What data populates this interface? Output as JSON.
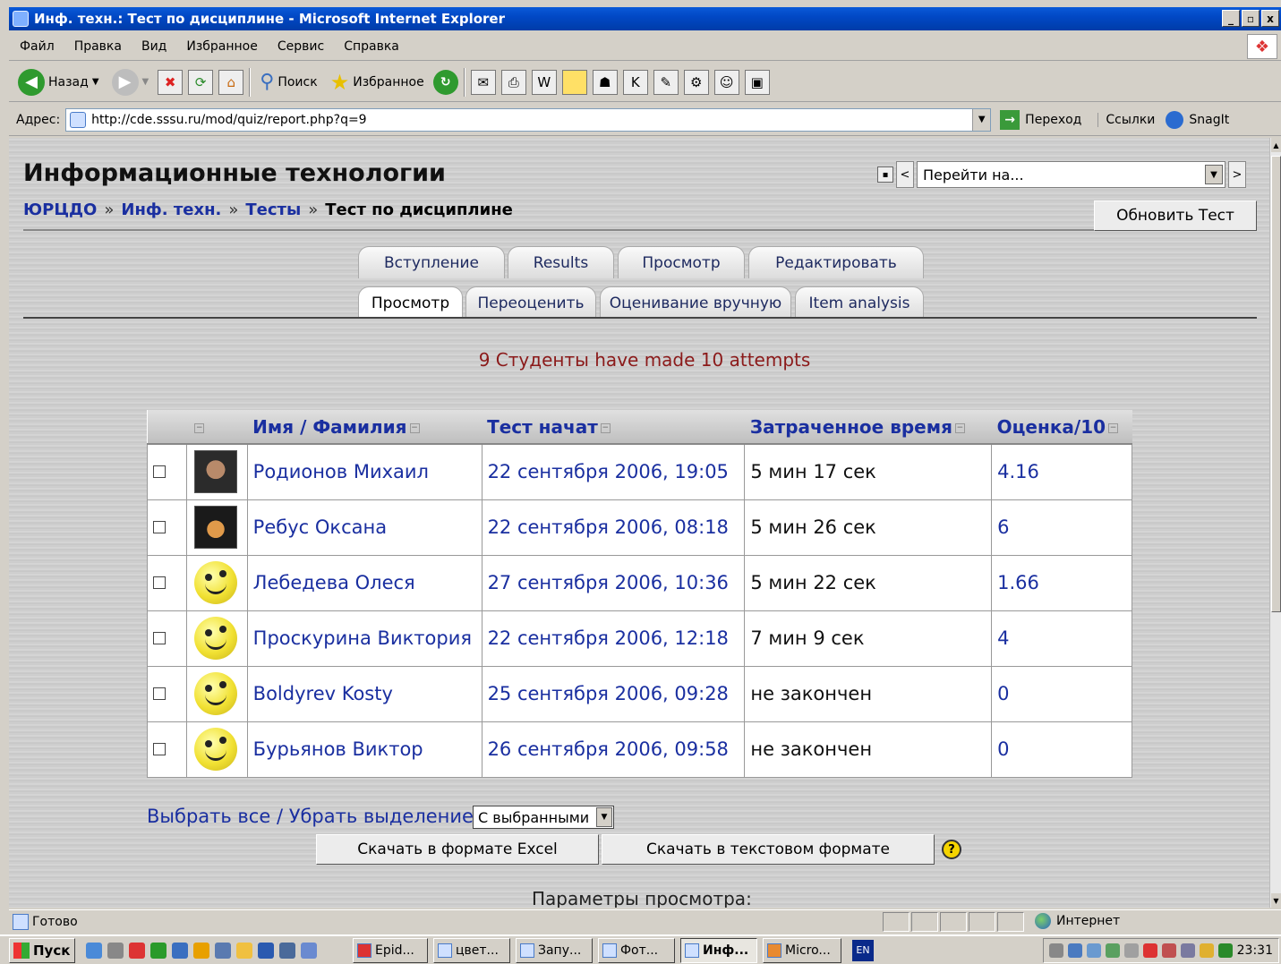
{
  "window": {
    "title": "Инф. техн.: Тест по дисциплине - Microsoft Internet Explorer",
    "min": "_",
    "max": "▫",
    "close": "x"
  },
  "menu": [
    "Файл",
    "Правка",
    "Вид",
    "Избранное",
    "Сервис",
    "Справка"
  ],
  "toolbar": {
    "back": "Назад",
    "search": "Поиск",
    "favorites": "Избранное"
  },
  "address": {
    "label": "Адрес:",
    "url": "http://cde.sssu.ru/mod/quiz/report.php?q=9",
    "go": "Переход",
    "links": "Ссылки",
    "snagit": "SnagIt"
  },
  "page": {
    "course_title": "Информационные технологии",
    "jump_placeholder": "Перейти на...",
    "jump_prev": "<",
    "jump_next": ">",
    "breadcrumb": [
      "ЮРЦДО",
      "Инф. техн.",
      "Тесты",
      "Тест по дисциплине"
    ],
    "breadcrumb_sep": "»",
    "update_button": "Обновить Тест",
    "tabs_top": [
      "Вступление",
      "Results",
      "Просмотр",
      "Редактировать"
    ],
    "tabs_bottom": [
      "Просмотр",
      "Переоценить",
      "Оценивание вручную",
      "Item analysis"
    ],
    "summary": "9 Студенты have made 10 attempts",
    "table": {
      "headers": [
        "Имя / Фамилия",
        "Тест начат",
        "Затраченное время",
        "Оценка/10"
      ],
      "rows": [
        {
          "name": "Родионов Михаил",
          "started": "22 сентября 2006, 19:05",
          "time": "5 мин 17 сек",
          "grade": "4.16",
          "avatar": "photo-1"
        },
        {
          "name": "Ребус Оксана",
          "started": "22 сентября 2006, 08:18",
          "time": "5 мин 26 сек",
          "grade": "6",
          "avatar": "photo-2"
        },
        {
          "name": "Лебедева Олеся",
          "started": "27 сентября 2006, 10:36",
          "time": "5 мин 22 сек",
          "grade": "1.66",
          "avatar": "smiley"
        },
        {
          "name": "Проскурина Виктория",
          "started": "22 сентября 2006, 12:18",
          "time": "7 мин 9 сек",
          "grade": "4",
          "avatar": "smiley"
        },
        {
          "name": "Boldyrev Kosty",
          "started": "25 сентября 2006, 09:28",
          "time": "не закончен",
          "grade": "0",
          "avatar": "smiley"
        },
        {
          "name": "Бурьянов Виктор",
          "started": "26 сентября 2006, 09:58",
          "time": "не закончен",
          "grade": "0",
          "avatar": "smiley"
        }
      ]
    },
    "select_all": "Выбрать все / Убрать выделение",
    "with_selected": "С выбранными",
    "download_excel": "Скачать в формате Excel",
    "download_text": "Скачать в текстовом формате",
    "help": "?",
    "view_params": "Параметры просмотра:"
  },
  "status": {
    "text": "Готово",
    "zone": "Интернет"
  },
  "taskbar": {
    "start": "Пуск",
    "tasks": [
      "Epid...",
      "цвет...",
      "Запу...",
      "Фот...",
      "Инф...",
      "Micro..."
    ],
    "active_index": 4,
    "lang": "EN",
    "clock": "23:31"
  }
}
